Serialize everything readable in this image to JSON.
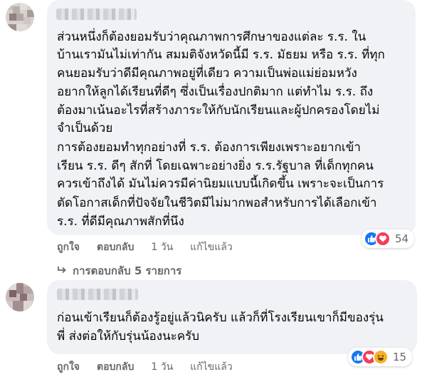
{
  "comments": [
    {
      "lines": [
        "ส่วนหนึ่งก็ต้องยอมรับว่าคุณภาพการศึกษาของแต่ละ ร.ร. ใน",
        "บ้านเรามันไม่เท่ากัน สมมติจังหวัดนี้มี ร.ร. มัธยม หรือ ร.ร. ที่ทุก",
        "คนยอมรับว่าดีมีคุณภาพอยู่ที่เดียว ความเป็นพ่อแม่ย่อมหวัง",
        "อยากให้ลูกได้เรียนที่ดีๆ ซึ่งเป็นเรื่องปกติมาก แต่ทำไม ร.ร. ถึง",
        "ต้องมาเน้นอะไรที่สร้างภาระให้กับนักเรียนและผู้ปกครองโดยไม่",
        "จำเป็นด้วย",
        "การต้องยอมทำทุกอย่างที่ ร.ร. ต้องการเพียงเพราะอยากเข้า",
        "เรียน ร.ร. ดีๆ สักที่ โดยเฉพาะอย่างยิ่ง ร.ร.รัฐบาล ที่เด็กทุกคน",
        "ควรเข้าถึงได้ มันไม่ควรมีค่านิยมแบบนี้เกิดขึ้น เพราะจะเป็นการ",
        "ตัดโอกาสเด็กที่ปัจจัยในชีวิตมีไม่มากพอสำหรับการได้เลือกเข้า",
        "ร.ร. ที่ดีมีคุณภาพสักที่นึง"
      ],
      "reaction_icons": [
        "like-icon",
        "love-icon"
      ],
      "reaction_count": "54",
      "like_label": "ถูกใจ",
      "reply_label": "ตอบกลับ",
      "time": "1 วัน",
      "edited": "แก้ไขแล้ว",
      "view_replies": "การตอบกลับ 5 รายการ"
    },
    {
      "lines": [
        "ก่อนเข้าเรียนก็ต้องรู้อยู่แล้วนิครับ แล้วก็ที่โรงเรียนเขาก็มีของรุ่น",
        "พี่ ส่งต่อให้กับรุ่นน้องนะครับ"
      ],
      "reaction_icons": [
        "like-icon",
        "love-icon",
        "haha-icon"
      ],
      "reaction_count": "15",
      "like_label": "ถูกใจ",
      "reply_label": "ตอบกลับ",
      "time": "1 วัน",
      "edited": "แก้ไขแล้ว"
    }
  ],
  "colors": {
    "bubble": "#f0f2f5",
    "text": "#050505",
    "meta": "#65676b",
    "like": "#1877f2",
    "love": "#f33e58",
    "haha": "#f7b125"
  }
}
